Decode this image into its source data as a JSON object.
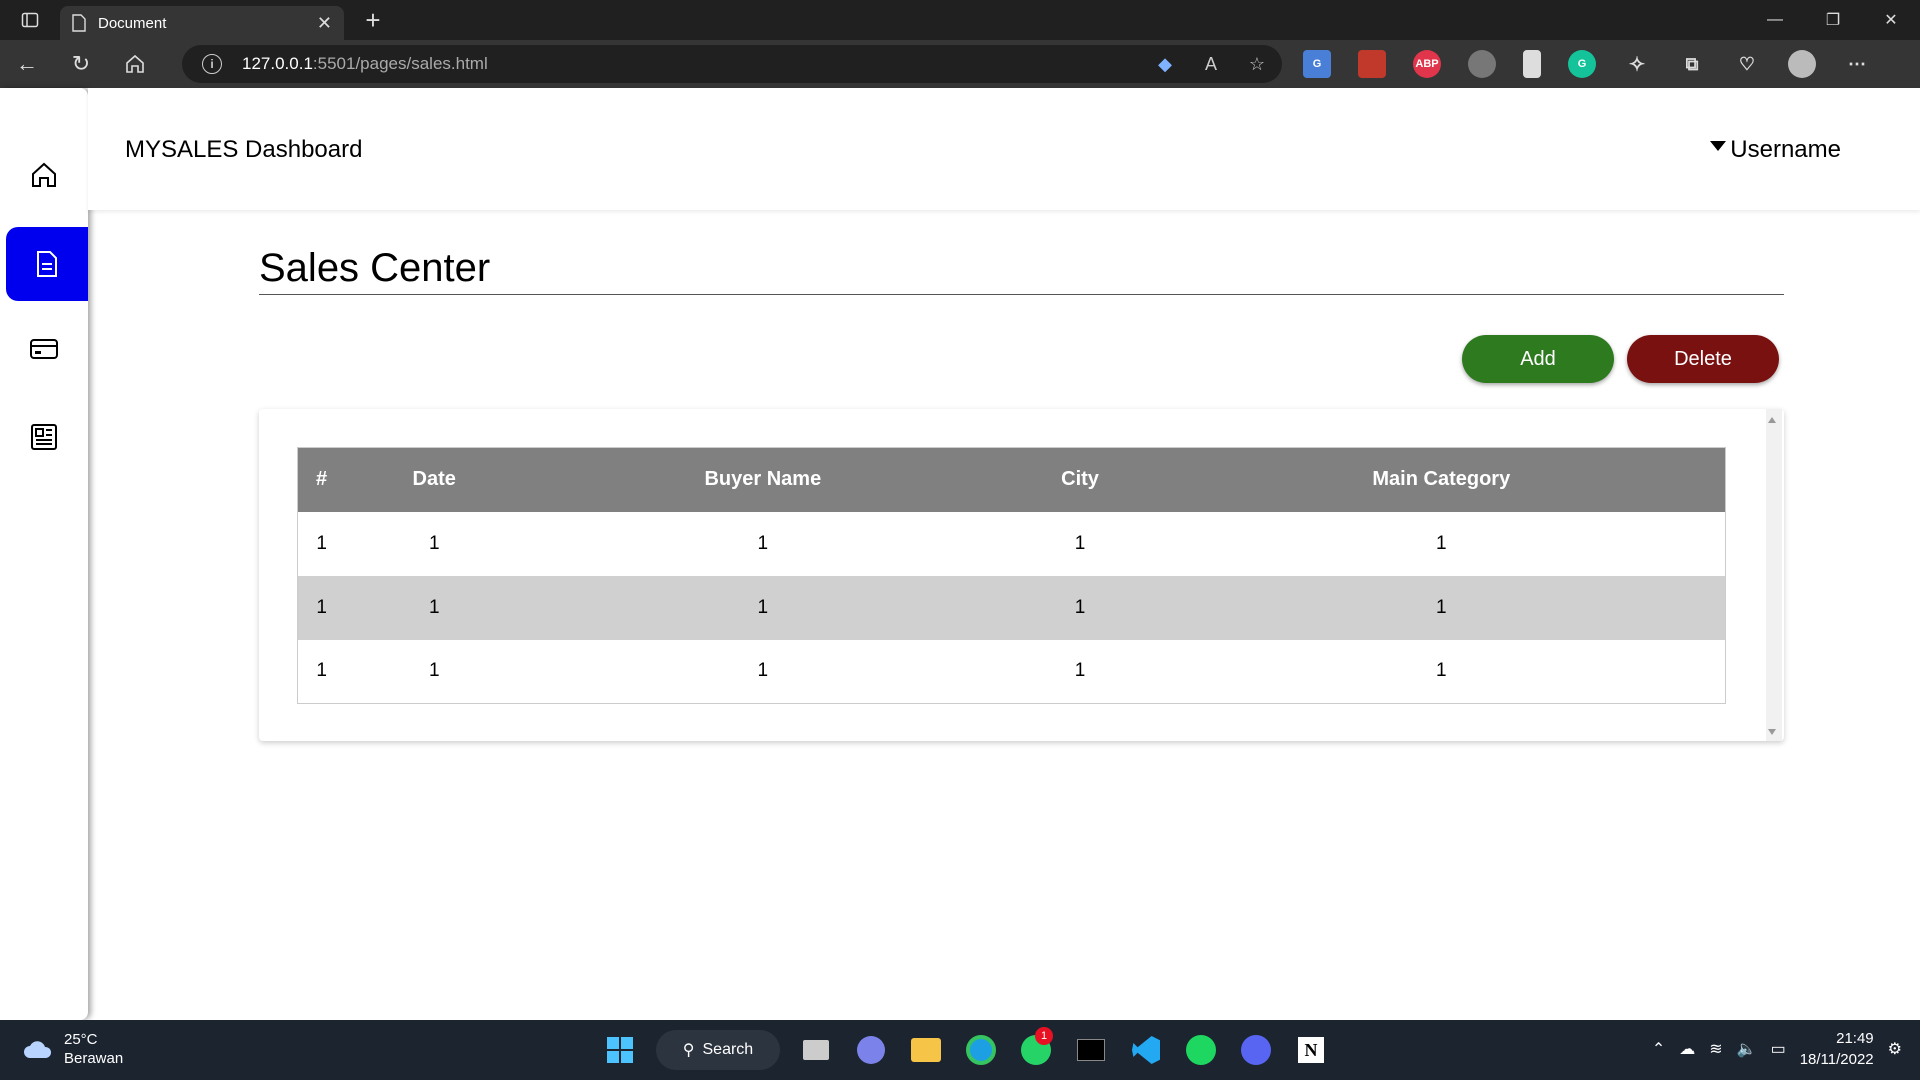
{
  "browser": {
    "tab_title": "Document",
    "url_host": "127.0.0.1",
    "url_path": ":5501/pages/sales.html"
  },
  "app": {
    "brand": "MYSALES Dashboard",
    "username": "Username",
    "page_title": "Sales Center",
    "add_label": "Add",
    "delete_label": "Delete",
    "accent_color": "#0000ee",
    "add_color": "#2d7a1f",
    "delete_color": "#7a1111"
  },
  "sidebar": {
    "items": [
      {
        "icon": "home-icon",
        "active": false
      },
      {
        "icon": "document-icon",
        "active": true
      },
      {
        "icon": "card-icon",
        "active": false
      },
      {
        "icon": "newspaper-icon",
        "active": false
      }
    ]
  },
  "table": {
    "headers": [
      "#",
      "Date",
      "Buyer Name",
      "City",
      "Main Category"
    ],
    "rows": [
      [
        "1",
        "1",
        "1",
        "1",
        "1"
      ],
      [
        "1",
        "1",
        "1",
        "1",
        "1"
      ],
      [
        "1",
        "1",
        "1",
        "1",
        "1"
      ]
    ]
  },
  "taskbar": {
    "temperature": "25°C",
    "weather": "Berawan",
    "search_label": "Search",
    "whatsapp_badge": "1",
    "time": "21:49",
    "date": "18/11/2022"
  }
}
